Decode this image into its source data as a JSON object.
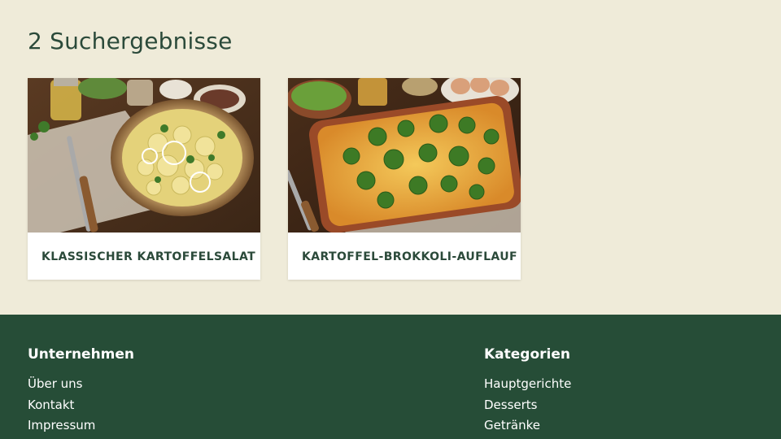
{
  "results": {
    "heading": "2 Suchergebnisse"
  },
  "cards": [
    {
      "title": "KLASSISCHER KARTOFFELSALAT"
    },
    {
      "title": "KARTOFFEL-BROKKOLI-AUFLAUF"
    }
  ],
  "footer": {
    "columns": [
      {
        "heading": "Unternehmen",
        "links": [
          "Über uns",
          "Kontakt",
          "Impressum"
        ]
      },
      {
        "heading": "Kategorien",
        "links": [
          "Hauptgerichte",
          "Desserts",
          "Getränke"
        ]
      }
    ]
  },
  "colors": {
    "page_background": "#efebd9",
    "footer_background": "#264d37",
    "heading_text": "#2b4a3a"
  }
}
